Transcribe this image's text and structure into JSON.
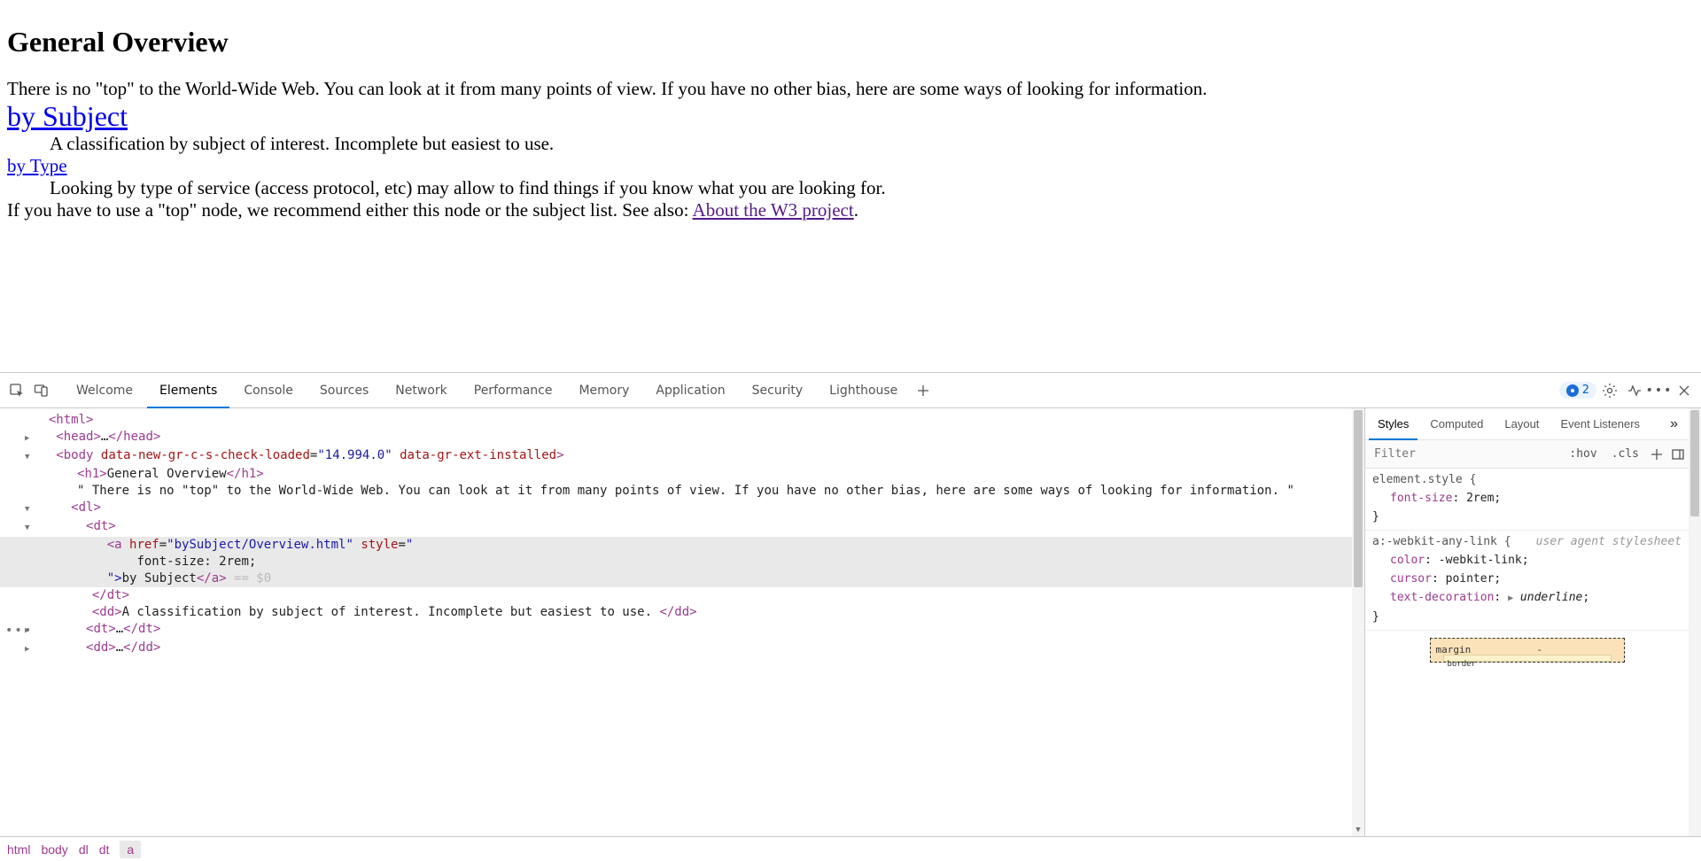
{
  "page": {
    "title": "General Overview",
    "intro": "There is no \"top\" to the World-Wide Web. You can look at it from many points of view. If you have no other bias, here are some ways of looking for information.",
    "links": {
      "bySubject": {
        "text": "by Subject",
        "desc": "A classification by subject of interest. Incomplete but easiest to use."
      },
      "byType": {
        "text": "by Type",
        "desc": "Looking by type of service (access protocol, etc) may allow to find things if you know what you are looking for."
      }
    },
    "footer_pre": "If you have to use a \"top\" node, we recommend either this node or the subject list. See also: ",
    "footer_link": "About the W3 project",
    "footer_post": "."
  },
  "devtools": {
    "tabs": [
      "Welcome",
      "Elements",
      "Console",
      "Sources",
      "Network",
      "Performance",
      "Memory",
      "Application",
      "Security",
      "Lighthouse"
    ],
    "active_tab": "Elements",
    "issue_count": "2",
    "styles_tabs": [
      "Styles",
      "Computed",
      "Layout",
      "Event Listeners"
    ],
    "styles_active": "Styles",
    "filter_placeholder": "Filter",
    "hov": ":hov",
    "cls": ".cls",
    "rules": {
      "elem_sel": "element.style {",
      "elem_prop_name": "font-size",
      "elem_prop_val": "2rem",
      "any_sel": "a:-webkit-any-link {",
      "any_note": "user agent stylesheet",
      "p1n": "color",
      "p1v": "-webkit-link",
      "p2n": "cursor",
      "p2v": "pointer",
      "p3n": "text-decoration",
      "p3v": "underline"
    },
    "boxmodel": {
      "label": "margin",
      "top": "-",
      "inner": "border"
    },
    "dom": {
      "l1": "<html>",
      "l2a": "<head>",
      "l2b": "…",
      "l2c": "</head>",
      "l3a": "<body",
      "l3attr1": "data-new-gr-c-s-check-loaded",
      "l3val1": "\"14.994.0\"",
      "l3attr2": "data-gr-ext-installed",
      "l3b": ">",
      "l4a": "<h1>",
      "l4t": "General Overview",
      "l4b": "</h1>",
      "l5": "\" There is no \"top\" to the World-Wide Web. You can look at it from many points of view. If you have no other bias, here are some ways of looking for information. \"",
      "l6": "<dl>",
      "l7": "<dt>",
      "l8a": "<a",
      "l8attr": "href",
      "l8val": "\"bySubject/Overview.html\"",
      "l8attr2": "style",
      "l8val2": "\"",
      "l8s1": "font-size: 2rem;",
      "l8s2": "\">",
      "l8t": "by Subject",
      "l8c": "</a>",
      "l8d": " == $0",
      "l9": "</dt>",
      "l10a": "<dd>",
      "l10t": "A classification by subject of interest. Incomplete but easiest to use. ",
      "l10b": "</dd>",
      "l11a": "<dt>",
      "l11b": "…",
      "l11c": "</dt>",
      "l12a": "<dd>",
      "l12b": "…",
      "l12c": "</dd>"
    },
    "crumbs": [
      "html",
      "body",
      "dl",
      "dt",
      "a"
    ]
  }
}
